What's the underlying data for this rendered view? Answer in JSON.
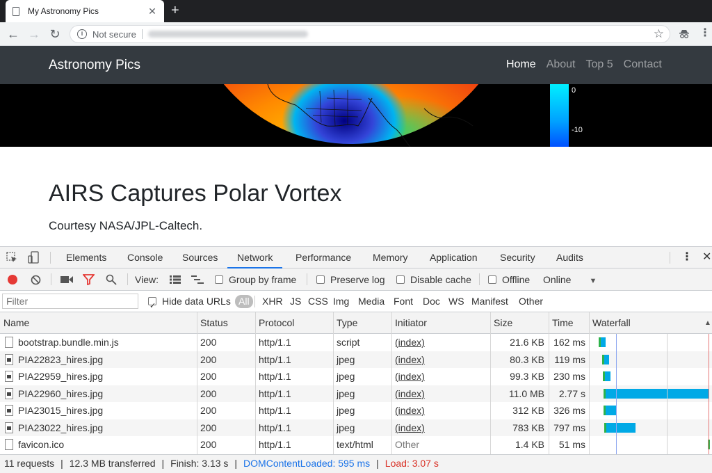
{
  "browser": {
    "tab_title": "My Astronomy Pics",
    "tab_close": "✕",
    "new_tab": "+",
    "security_label": "Not secure"
  },
  "site": {
    "brand": "Astronomy Pics",
    "nav": [
      "Home",
      "About",
      "Top 5",
      "Contact"
    ],
    "colorbar_labels": [
      "0",
      "-10"
    ],
    "article_title": "AIRS Captures Polar Vortex",
    "article_subtitle": "Courtesy NASA/JPL-Caltech."
  },
  "devtools": {
    "tabs": [
      "Elements",
      "Console",
      "Sources",
      "Network",
      "Performance",
      "Memory",
      "Application",
      "Security",
      "Audits"
    ],
    "active_tab": "Network",
    "toolbar": {
      "view_label": "View:",
      "group_by_frame": "Group by frame",
      "preserve_log": "Preserve log",
      "disable_cache": "Disable cache",
      "offline": "Offline",
      "throttling": "Online"
    },
    "filter": {
      "placeholder": "Filter",
      "hide_data_urls": "Hide data URLs",
      "types": [
        "All",
        "XHR",
        "JS",
        "CSS",
        "Img",
        "Media",
        "Font",
        "Doc",
        "WS",
        "Manifest",
        "Other"
      ]
    },
    "columns": [
      "Name",
      "Status",
      "Protocol",
      "Type",
      "Initiator",
      "Size",
      "Time",
      "Waterfall"
    ],
    "rows": [
      {
        "name": "bootstrap.bundle.min.js",
        "status": "200",
        "protocol": "http/1.1",
        "type": "script",
        "initiator": "(index)",
        "size": "21.6 KB",
        "time": "162 ms"
      },
      {
        "name": "PIA22823_hires.jpg",
        "status": "200",
        "protocol": "http/1.1",
        "type": "jpeg",
        "initiator": "(index)",
        "size": "80.3 KB",
        "time": "119 ms"
      },
      {
        "name": "PIA22959_hires.jpg",
        "status": "200",
        "protocol": "http/1.1",
        "type": "jpeg",
        "initiator": "(index)",
        "size": "99.3 KB",
        "time": "230 ms"
      },
      {
        "name": "PIA22960_hires.jpg",
        "status": "200",
        "protocol": "http/1.1",
        "type": "jpeg",
        "initiator": "(index)",
        "size": "11.0 MB",
        "time": "2.77 s"
      },
      {
        "name": "PIA23015_hires.jpg",
        "status": "200",
        "protocol": "http/1.1",
        "type": "jpeg",
        "initiator": "(index)",
        "size": "312 KB",
        "time": "326 ms"
      },
      {
        "name": "PIA23022_hires.jpg",
        "status": "200",
        "protocol": "http/1.1",
        "type": "jpeg",
        "initiator": "(index)",
        "size": "783 KB",
        "time": "797 ms"
      },
      {
        "name": "favicon.ico",
        "status": "200",
        "protocol": "http/1.1",
        "type": "text/html",
        "initiator": "Other",
        "size": "1.4 KB",
        "time": "51 ms"
      }
    ],
    "summary": {
      "requests": "11 requests",
      "transferred": "12.3 MB transferred",
      "finish": "Finish: 3.13 s",
      "dom_content_loaded": "DOMContentLoaded: 595 ms",
      "load": "Load: 3.07 s"
    },
    "colors": {
      "accent": "#1a73e8",
      "waterfall_download": "#00a9e6",
      "waterfall_waiting": "#2db34a",
      "load_line": "#d93025",
      "dcl_line": "#1a73e8"
    }
  }
}
